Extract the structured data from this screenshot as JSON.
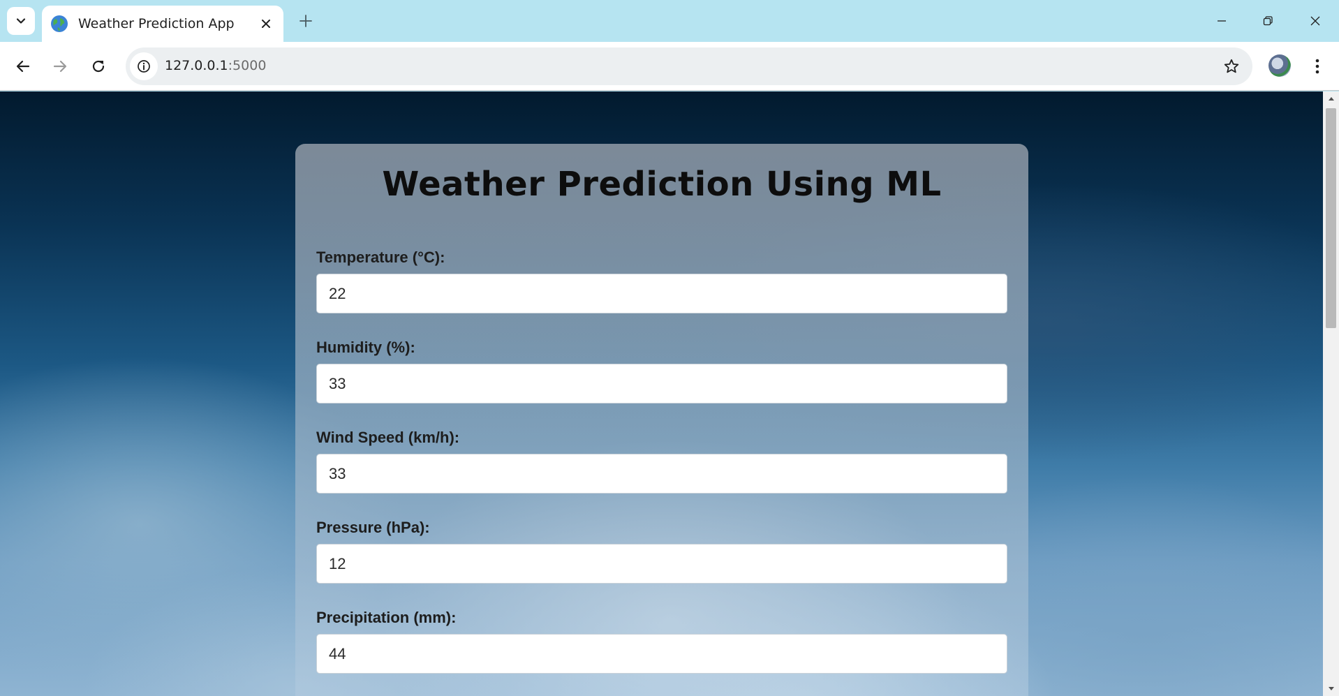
{
  "browser": {
    "tab_title": "Weather Prediction App",
    "url_host": "127.0.0.1",
    "url_port": ":5000",
    "icons": {
      "tab_list": "chevron-down-icon",
      "favicon": "globe-icon",
      "tab_close": "close-icon",
      "new_tab": "plus-icon",
      "back": "arrow-left-icon",
      "forward": "arrow-right-icon",
      "reload": "reload-icon",
      "site_info": "info-icon",
      "bookmark": "star-icon",
      "menu": "kebab-icon"
    }
  },
  "page": {
    "title": "Weather Prediction Using ML",
    "fields": [
      {
        "label": "Temperature (°C):",
        "value": "22"
      },
      {
        "label": "Humidity (%):",
        "value": "33"
      },
      {
        "label": "Wind Speed (km/h):",
        "value": "33"
      },
      {
        "label": "Pressure (hPa):",
        "value": "12"
      },
      {
        "label": "Precipitation (mm):",
        "value": "44"
      }
    ]
  },
  "colors": {
    "tabbar_bg": "#b6e4f1",
    "card_text": "#0d0d0d"
  }
}
